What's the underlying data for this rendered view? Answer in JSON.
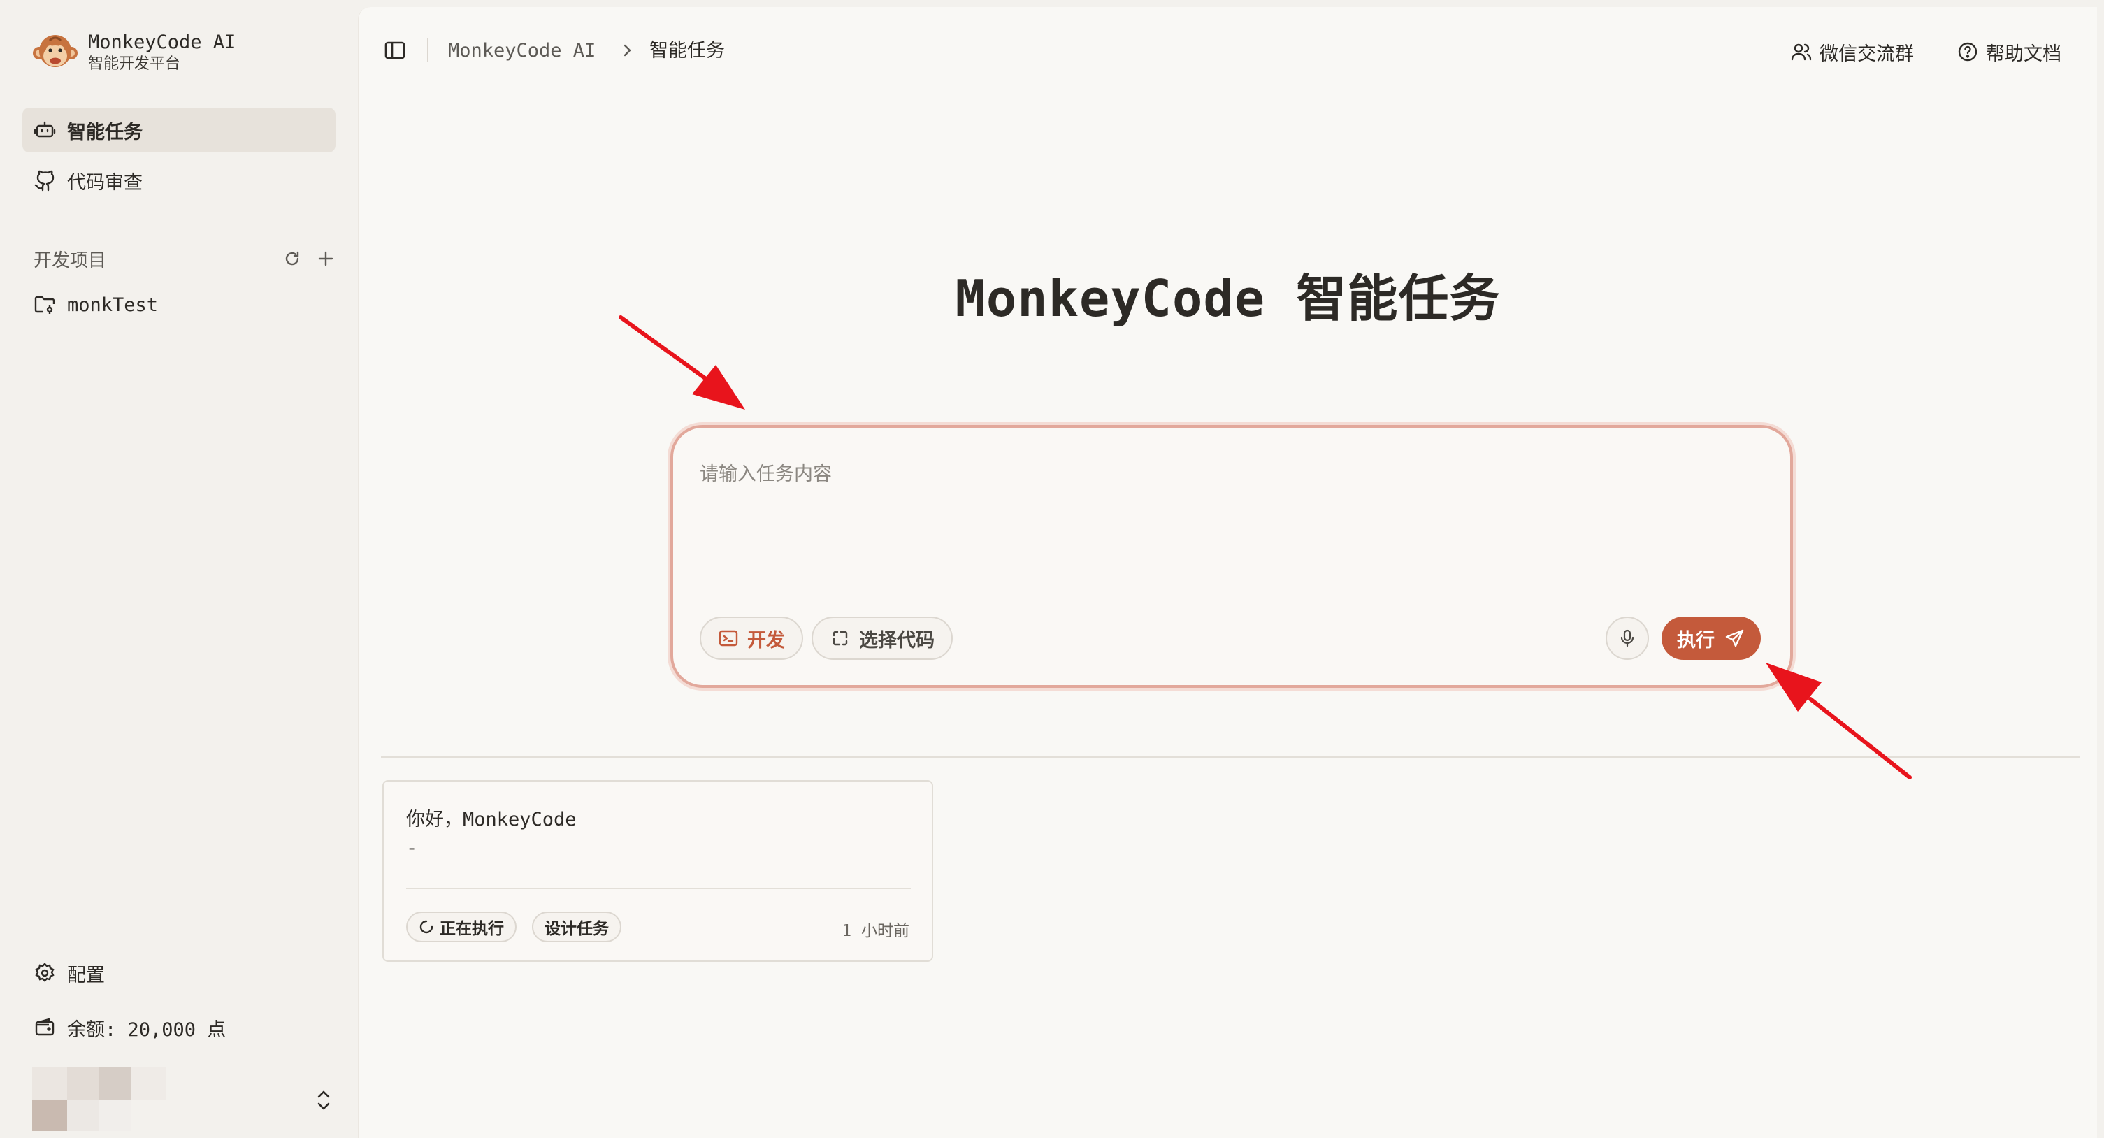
{
  "brand": {
    "name": "MonkeyCode AI",
    "subtitle": "智能开发平台"
  },
  "sidebar": {
    "nav": [
      {
        "label": "智能任务",
        "icon": "robot-icon",
        "active": true
      },
      {
        "label": "代码审查",
        "icon": "github-icon",
        "active": false
      }
    ],
    "section_title": "开发项目",
    "projects": [
      {
        "label": "monkTest",
        "icon": "folder-git-icon"
      }
    ],
    "settings_label": "配置",
    "balance_label": "余额: 20,000 点"
  },
  "topbar": {
    "breadcrumb": [
      "MonkeyCode AI",
      "智能任务"
    ],
    "wechat_label": "微信交流群",
    "help_label": "帮助文档"
  },
  "hero": {
    "title": "MonkeyCode 智能任务"
  },
  "composer": {
    "placeholder": "请输入任务内容",
    "dev_chip": "开发",
    "code_chip": "选择代码",
    "run_label": "执行"
  },
  "tasks": [
    {
      "title": "你好，MonkeyCode",
      "desc": "-",
      "status": "正在执行",
      "type": "设计任务",
      "time": "1 小时前"
    }
  ],
  "colors": {
    "accent": "#c45a3b",
    "annotation": "#e8141c",
    "sidebar_bg": "#f3f1ed",
    "main_bg": "#f9f8f5"
  }
}
